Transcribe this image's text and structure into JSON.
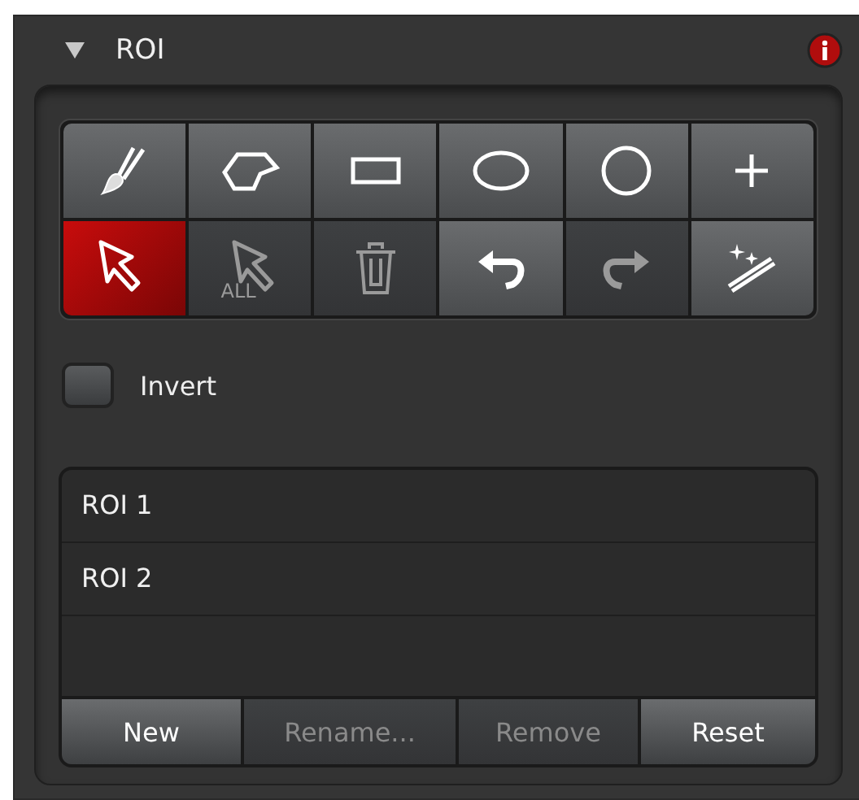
{
  "panel": {
    "title": "ROI",
    "expanded": true
  },
  "tools": [
    {
      "kind": "brush",
      "selected": false,
      "disabled": false
    },
    {
      "kind": "polygon",
      "selected": false,
      "disabled": false
    },
    {
      "kind": "rectangle",
      "selected": false,
      "disabled": false
    },
    {
      "kind": "ellipse",
      "selected": false,
      "disabled": false
    },
    {
      "kind": "circle",
      "selected": false,
      "disabled": false
    },
    {
      "kind": "point",
      "selected": false,
      "disabled": false
    },
    {
      "kind": "select",
      "selected": true,
      "disabled": false
    },
    {
      "kind": "select-all",
      "label": "ALL",
      "selected": false,
      "disabled": true
    },
    {
      "kind": "delete",
      "selected": false,
      "disabled": true
    },
    {
      "kind": "undo",
      "selected": false,
      "disabled": false
    },
    {
      "kind": "redo",
      "selected": false,
      "disabled": true
    },
    {
      "kind": "magic",
      "selected": false,
      "disabled": false
    }
  ],
  "invert": {
    "label": "Invert",
    "checked": false
  },
  "roi_list": [
    {
      "name": "ROI 1",
      "selected": false
    },
    {
      "name": "ROI 2",
      "selected": false
    }
  ],
  "buttons": [
    {
      "label": "New",
      "disabled": false
    },
    {
      "label": "Rename...",
      "disabled": true
    },
    {
      "label": "Remove",
      "disabled": true
    },
    {
      "label": "Reset",
      "disabled": false
    }
  ]
}
